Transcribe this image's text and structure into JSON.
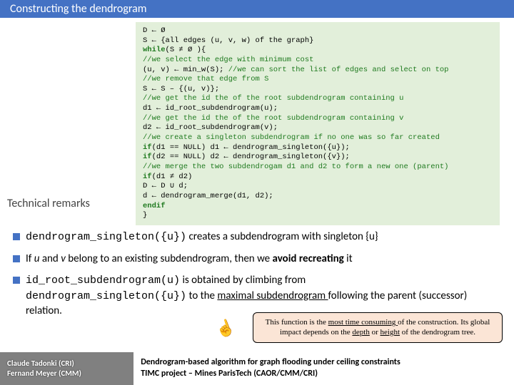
{
  "title": "Constructing the dendrogram",
  "remarks_label": "Technical remarks",
  "code": {
    "l1": "D ← Ø",
    "l2": "S ← {all edges (u, v, w) of the graph}",
    "l3a": "while",
    "l3b": "(S ≠ Ø ){",
    "l4a": "    //we select the edge with minimum cost",
    "l5a": "    (u, v) ← min_w(S); ",
    "l5b": "//we can sort the list of edges and select on top",
    "l6a": "    //we remove that edge from S",
    "l7": "    S ← S – {(u, v)};",
    "l8a": "    //we get the id the of the root subdendrogram containing u",
    "l9": "    d1 ← id_root_subdendrogram(u);",
    "l10a": "    //we get the id the of the root subdendrogram containing v",
    "l11": "    d2 ← id_root_subdendrogram(v);",
    "l12a": "    //we create a singleton subdendrogram if no one was so far created",
    "l13a": "    if",
    "l13b": "(d1 == NULL) d1 ← dendrogram_singleton({u});",
    "l14a": "    if",
    "l14b": "(d2 == NULL) d2 ← dendrogram_singleton({v});",
    "l15a": "    //we merge the two subdendrogam d1 and d2 to form a new one (parent)",
    "l16a": "    if",
    "l16b": "(d1 ≠ d2)",
    "l17": "      D ← D ∪ d;",
    "l18": "      d ← dendrogram_merge(d1, d2);",
    "l19a": "    endif",
    "l20": "}"
  },
  "b1": {
    "pre": "dendrogram_singleton({u})",
    "mid": " creates a subdendrogram with singleton {u}"
  },
  "b2": {
    "a": "If ",
    "b": "u",
    "c": " and ",
    "d": "v",
    "e": " belong to an existing subdendrogram, then we ",
    "f": "avoid recreating",
    "g": " it"
  },
  "b3": {
    "a": "id_root_subdendrogram(u)",
    "b": "  is obtained by climbing from ",
    "c": "dendrogram_singleton({u})",
    "d": " to the ",
    "e": "maximal subdendrogram ",
    "f": "following the parent (successor) relation."
  },
  "callout": {
    "a": "This function is the ",
    "b": "most time consuming ",
    "c": "of the construction. Its global impact depends on the ",
    "d": "depth",
    "e": " or ",
    "f": "height",
    "g": " of the dendrogram tree."
  },
  "footer": {
    "author1": "Claude Tadonki (CRI)",
    "author2": "Fernand Meyer (CMM)",
    "title1": "Dendrogram-based algorithm for graph flooding under ceiling constraints",
    "title2": "TIMC project – Mines ParisTech (CAOR/CMM/CRI)"
  }
}
